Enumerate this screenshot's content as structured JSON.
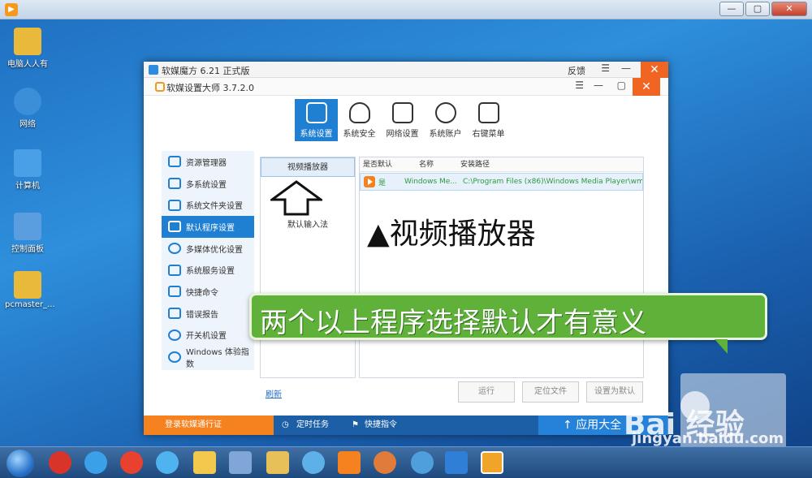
{
  "desktop_icons": [
    {
      "label": "电脑人人有",
      "color": "#e8b93b"
    },
    {
      "label": "网络",
      "color": "#3b8fd8"
    },
    {
      "label": "计算机",
      "color": "#4aa0e6"
    },
    {
      "label": "控制面板",
      "color": "#5a9ee0"
    },
    {
      "label": "pcmaster_...",
      "color": "#e8b93b"
    }
  ],
  "app": {
    "title": "软媒魔方 6.21 正式版",
    "feedback": "反馈",
    "sub_title": "软媒设置大师 3.7.2.0",
    "tabs": [
      {
        "label": "系统设置",
        "active": true
      },
      {
        "label": "系统安全",
        "active": false
      },
      {
        "label": "网络设置",
        "active": false
      },
      {
        "label": "系统账户",
        "active": false
      },
      {
        "label": "右键菜单",
        "active": false
      }
    ],
    "sidebar": [
      {
        "label": "资源管理器",
        "active": false
      },
      {
        "label": "多系统设置",
        "active": false
      },
      {
        "label": "系统文件夹设置",
        "active": false
      },
      {
        "label": "默认程序设置",
        "active": true
      },
      {
        "label": "多媒体优化设置",
        "active": false
      },
      {
        "label": "系统服务设置",
        "active": false
      },
      {
        "label": "快捷命令",
        "active": false
      },
      {
        "label": "错误报告",
        "active": false
      },
      {
        "label": "开关机设置",
        "active": false
      },
      {
        "label": "Windows 体验指数",
        "active": false
      }
    ],
    "categories": [
      {
        "label": "视频播放器",
        "active": true
      },
      {
        "label": "默认输入法",
        "active": false
      }
    ],
    "table": {
      "headers": [
        "是否默认",
        "名称",
        "安装路径"
      ],
      "rows": [
        {
          "default": "是",
          "name": "Windows Me...",
          "path": "C:\\Program Files (x86)\\Windows Media Player\\wm..."
        }
      ]
    },
    "refresh": "刷新",
    "buttons": {
      "run": "运行",
      "locate": "定位文件",
      "set_default": "设置为默认"
    },
    "bottom": {
      "login": "登录软媒通行证",
      "timer": "定时任务",
      "quick": "快捷指令",
      "right": "应用大全"
    }
  },
  "overlay": {
    "caption": "▲视频播放器",
    "banner": "两个以上程序选择默认才有意义"
  },
  "watermark": {
    "logo": "Bai 经验",
    "sub": "jingyan.baidu.com"
  }
}
